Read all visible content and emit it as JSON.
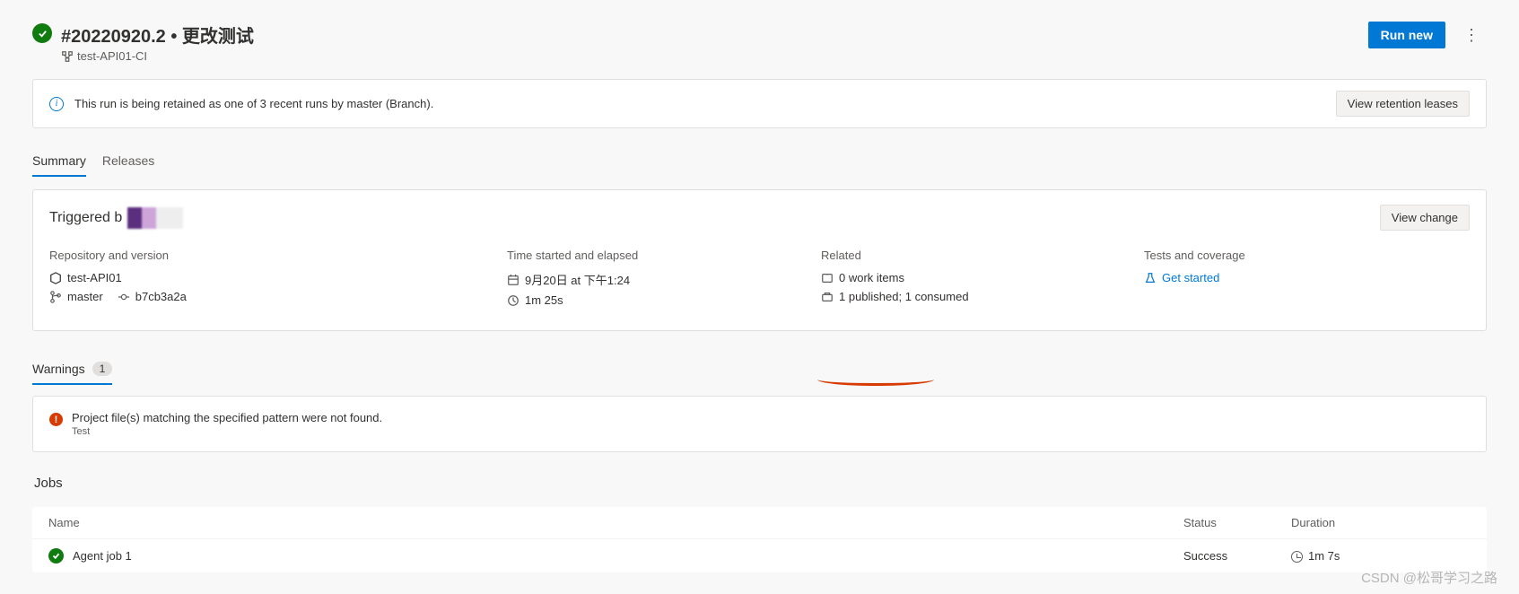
{
  "header": {
    "run_title": "#20220920.2 • 更改测试",
    "pipeline_name": "test-API01-CI",
    "run_new_label": "Run new",
    "view_leases_label": "View retention leases",
    "retention_message": "This run is being retained as one of 3 recent runs by master (Branch)."
  },
  "tabs": {
    "summary": "Summary",
    "releases": "Releases"
  },
  "triggered": {
    "prefix": "Triggered b",
    "view_change_label": "View change"
  },
  "details": {
    "repo_version_heading": "Repository and version",
    "repo_name": "test-API01",
    "branch": "master",
    "commit": "b7cb3a2a",
    "time_heading": "Time started and elapsed",
    "start_time": "9月20日 at 下午1:24",
    "elapsed": "1m 25s",
    "related_heading": "Related",
    "work_items": "0 work items",
    "artifacts": "1 published; 1 consumed",
    "tests_heading": "Tests and coverage",
    "get_started": "Get started"
  },
  "warnings": {
    "tab_label": "Warnings",
    "count": "1",
    "message": "Project file(s) matching the specified pattern were not found.",
    "sub": "Test"
  },
  "jobs": {
    "heading": "Jobs",
    "col_name": "Name",
    "col_status": "Status",
    "col_duration": "Duration",
    "rows": [
      {
        "name": "Agent job 1",
        "status": "Success",
        "duration": "1m 7s"
      }
    ]
  },
  "watermark": "CSDN @松哥学习之路"
}
